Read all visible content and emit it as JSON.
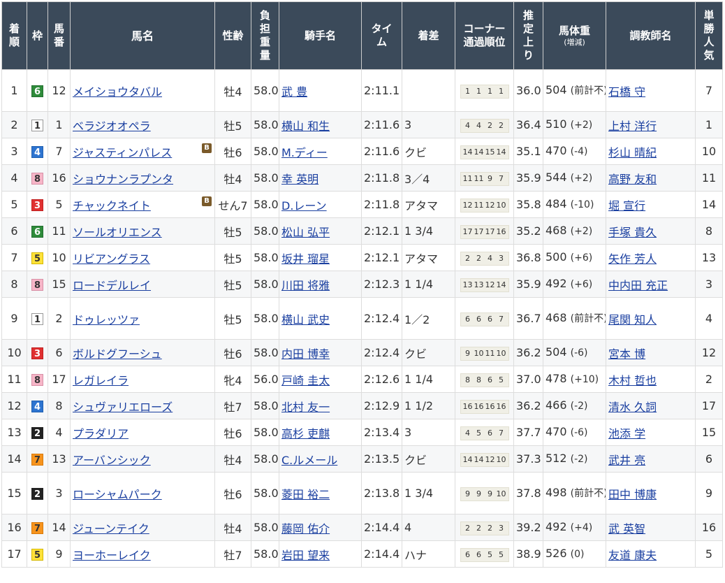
{
  "headers": {
    "rank": [
      "着",
      "順"
    ],
    "waku": "枠",
    "num": [
      "馬",
      "番"
    ],
    "horse": "馬名",
    "sexage": "性齢",
    "weight": [
      "負",
      "担",
      "重",
      "量"
    ],
    "jockey": "騎手名",
    "time": [
      "タイ",
      "ム"
    ],
    "margin": "着差",
    "corner": [
      "コーナー",
      "通過順位"
    ],
    "last3f": [
      "推",
      "定",
      "上",
      "り"
    ],
    "bodyweight": [
      "馬体重",
      "(増減)"
    ],
    "trainer": "調教師名",
    "pop": [
      "単",
      "勝",
      "人",
      "気"
    ]
  },
  "blinker_label": "B",
  "rows": [
    {
      "rank": "1",
      "waku": "6",
      "num": "12",
      "horse": "メイショウタバル",
      "blinker": false,
      "sexage": "牡4",
      "weight": "58.0",
      "jockey": "武 豊",
      "time": "2:11.1",
      "margin": "",
      "corner": [
        "1",
        "1",
        "1",
        "1"
      ],
      "last3f": "36.0",
      "bw": "504",
      "bwdiff": "",
      "bwnote": "(前計不)",
      "trainer": "石橋 守",
      "pop": "7",
      "tall": true
    },
    {
      "rank": "2",
      "waku": "1",
      "num": "1",
      "horse": "ベラジオオペラ",
      "blinker": false,
      "sexage": "牡5",
      "weight": "58.0",
      "jockey": "横山 和生",
      "time": "2:11.6",
      "margin": "3",
      "corner": [
        "4",
        "4",
        "2",
        "2"
      ],
      "last3f": "36.4",
      "bw": "510",
      "bwdiff": "(+2)",
      "bwnote": "",
      "trainer": "上村 洋行",
      "pop": "1",
      "tall": false
    },
    {
      "rank": "3",
      "waku": "4",
      "num": "7",
      "horse": "ジャスティンパレス",
      "blinker": true,
      "sexage": "牡6",
      "weight": "58.0",
      "jockey": "M.ディー",
      "time": "2:11.6",
      "margin": "クビ",
      "corner": [
        "14",
        "14",
        "15",
        "14"
      ],
      "last3f": "35.1",
      "bw": "470",
      "bwdiff": "(-4)",
      "bwnote": "",
      "trainer": "杉山 晴紀",
      "pop": "10",
      "tall": false
    },
    {
      "rank": "4",
      "waku": "8",
      "num": "16",
      "horse": "ショウナンラプンタ",
      "blinker": false,
      "sexage": "牡4",
      "weight": "58.0",
      "jockey": "幸 英明",
      "time": "2:11.8",
      "margin": "3／4",
      "corner": [
        "11",
        "11",
        "9",
        "7"
      ],
      "last3f": "35.9",
      "bw": "544",
      "bwdiff": "(+2)",
      "bwnote": "",
      "trainer": "高野 友和",
      "pop": "11",
      "tall": false
    },
    {
      "rank": "5",
      "waku": "3",
      "num": "5",
      "horse": "チャックネイト",
      "blinker": true,
      "sexage": "せん7",
      "weight": "58.0",
      "jockey": "D.レーン",
      "time": "2:11.8",
      "margin": "アタマ",
      "corner": [
        "12",
        "11",
        "12",
        "10"
      ],
      "last3f": "35.8",
      "bw": "484",
      "bwdiff": "(-10)",
      "bwnote": "",
      "trainer": "堀 宣行",
      "pop": "14",
      "tall": false
    },
    {
      "rank": "6",
      "waku": "6",
      "num": "11",
      "horse": "ソールオリエンス",
      "blinker": false,
      "sexage": "牡5",
      "weight": "58.0",
      "jockey": "松山 弘平",
      "time": "2:12.1",
      "margin": "1 3/4",
      "corner": [
        "17",
        "17",
        "17",
        "16"
      ],
      "last3f": "35.2",
      "bw": "468",
      "bwdiff": "(+2)",
      "bwnote": "",
      "trainer": "手塚 貴久",
      "pop": "8",
      "tall": false
    },
    {
      "rank": "7",
      "waku": "5",
      "num": "10",
      "horse": "リビアングラス",
      "blinker": false,
      "sexage": "牡5",
      "weight": "58.0",
      "jockey": "坂井 瑠星",
      "time": "2:12.1",
      "margin": "アタマ",
      "corner": [
        "2",
        "2",
        "4",
        "3"
      ],
      "last3f": "36.8",
      "bw": "500",
      "bwdiff": "(+6)",
      "bwnote": "",
      "trainer": "矢作 芳人",
      "pop": "13",
      "tall": false
    },
    {
      "rank": "8",
      "waku": "8",
      "num": "15",
      "horse": "ロードデルレイ",
      "blinker": false,
      "sexage": "牡5",
      "weight": "58.0",
      "jockey": "川田 将雅",
      "time": "2:12.3",
      "margin": "1 1/4",
      "corner": [
        "13",
        "13",
        "12",
        "14"
      ],
      "last3f": "35.9",
      "bw": "492",
      "bwdiff": "(+6)",
      "bwnote": "",
      "trainer": "中内田 充正",
      "pop": "3",
      "tall": false
    },
    {
      "rank": "9",
      "waku": "1",
      "num": "2",
      "horse": "ドゥレッツァ",
      "blinker": false,
      "sexage": "牡5",
      "weight": "58.0",
      "jockey": "横山 武史",
      "time": "2:12.4",
      "margin": "1／2",
      "corner": [
        "6",
        "6",
        "6",
        "7"
      ],
      "last3f": "36.7",
      "bw": "468",
      "bwdiff": "",
      "bwnote": "(前計不)",
      "trainer": "尾関 知人",
      "pop": "4",
      "tall": true
    },
    {
      "rank": "10",
      "waku": "3",
      "num": "6",
      "horse": "ボルドグフーシュ",
      "blinker": false,
      "sexage": "牡6",
      "weight": "58.0",
      "jockey": "内田 博幸",
      "time": "2:12.4",
      "margin": "クビ",
      "corner": [
        "9",
        "10",
        "11",
        "10"
      ],
      "last3f": "36.2",
      "bw": "504",
      "bwdiff": "(-6)",
      "bwnote": "",
      "trainer": "宮本 博",
      "pop": "12",
      "tall": false
    },
    {
      "rank": "11",
      "waku": "8",
      "num": "17",
      "horse": "レガレイラ",
      "blinker": false,
      "sexage": "牝4",
      "weight": "56.0",
      "jockey": "戸崎 圭太",
      "time": "2:12.6",
      "margin": "1 1/4",
      "corner": [
        "8",
        "8",
        "6",
        "5"
      ],
      "last3f": "37.0",
      "bw": "478",
      "bwdiff": "(+10)",
      "bwnote": "",
      "trainer": "木村 哲也",
      "pop": "2",
      "tall": false
    },
    {
      "rank": "12",
      "waku": "4",
      "num": "8",
      "horse": "シュヴァリエローズ",
      "blinker": false,
      "sexage": "牡7",
      "weight": "58.0",
      "jockey": "北村 友一",
      "time": "2:12.9",
      "margin": "1 1/2",
      "corner": [
        "16",
        "16",
        "16",
        "16"
      ],
      "last3f": "36.2",
      "bw": "466",
      "bwdiff": "(-2)",
      "bwnote": "",
      "trainer": "清水 久詞",
      "pop": "17",
      "tall": false
    },
    {
      "rank": "13",
      "waku": "2",
      "num": "4",
      "horse": "プラダリア",
      "blinker": false,
      "sexage": "牡6",
      "weight": "58.0",
      "jockey": "高杉 吏麒",
      "time": "2:13.4",
      "margin": "3",
      "corner": [
        "4",
        "5",
        "6",
        "7"
      ],
      "last3f": "37.7",
      "bw": "470",
      "bwdiff": "(-6)",
      "bwnote": "",
      "trainer": "池添 学",
      "pop": "15",
      "tall": false
    },
    {
      "rank": "14",
      "waku": "7",
      "num": "13",
      "horse": "アーバンシック",
      "blinker": false,
      "sexage": "牡4",
      "weight": "58.0",
      "jockey": "C.ルメール",
      "time": "2:13.5",
      "margin": "クビ",
      "corner": [
        "14",
        "14",
        "12",
        "10"
      ],
      "last3f": "37.3",
      "bw": "512",
      "bwdiff": "(-2)",
      "bwnote": "",
      "trainer": "武井 亮",
      "pop": "6",
      "tall": false
    },
    {
      "rank": "15",
      "waku": "2",
      "num": "3",
      "horse": "ローシャムパーク",
      "blinker": false,
      "sexage": "牡6",
      "weight": "58.0",
      "jockey": "菱田 裕二",
      "time": "2:13.8",
      "margin": "1 3/4",
      "corner": [
        "9",
        "9",
        "9",
        "10"
      ],
      "last3f": "37.8",
      "bw": "498",
      "bwdiff": "",
      "bwnote": "(前計不)",
      "trainer": "田中 博康",
      "pop": "9",
      "tall": true
    },
    {
      "rank": "16",
      "waku": "7",
      "num": "14",
      "horse": "ジューンテイク",
      "blinker": false,
      "sexage": "牡4",
      "weight": "58.0",
      "jockey": "藤岡 佑介",
      "time": "2:14.4",
      "margin": "4",
      "corner": [
        "2",
        "2",
        "2",
        "3"
      ],
      "last3f": "39.2",
      "bw": "492",
      "bwdiff": "(+4)",
      "bwnote": "",
      "trainer": "武 英智",
      "pop": "16",
      "tall": false
    },
    {
      "rank": "17",
      "waku": "5",
      "num": "9",
      "horse": "ヨーホーレイク",
      "blinker": false,
      "sexage": "牡7",
      "weight": "58.0",
      "jockey": "岩田 望来",
      "time": "2:14.4",
      "margin": "ハナ",
      "corner": [
        "6",
        "6",
        "5",
        "5"
      ],
      "last3f": "38.9",
      "bw": "526",
      "bwdiff": "(0)",
      "bwnote": "",
      "trainer": "友道 康夫",
      "pop": "5",
      "tall": false
    }
  ]
}
